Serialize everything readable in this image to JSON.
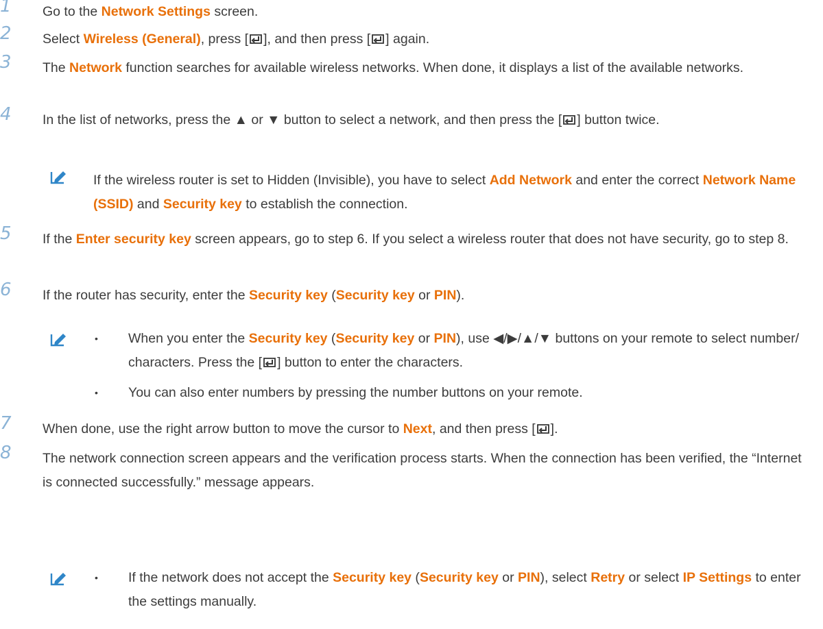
{
  "steps": [
    {
      "num": "1",
      "parts": [
        "Go to the ",
        "Network Settings",
        " screen."
      ]
    },
    {
      "num": "2",
      "parts": [
        "Select ",
        "Wireless (General)",
        ", press [",
        "], and then press [",
        "] again."
      ]
    },
    {
      "num": "3",
      "parts": [
        "The ",
        "Network",
        " function searches for available wireless networks. When done, it displays a list of the available networks."
      ]
    },
    {
      "num": "4",
      "parts": [
        "In the list of networks, press the ▲ or ▼ button to select a network, and then press the [",
        "] button twice."
      ]
    },
    {
      "num": "5",
      "parts": [
        "If the ",
        "Enter security key",
        " screen appears, go to step 6. If you select a wireless router that does not have security, go to step 8."
      ]
    },
    {
      "num": "6",
      "parts": [
        "If the router has security, enter the ",
        "Security key",
        " (",
        "Security key",
        " or ",
        "PIN",
        ")."
      ]
    },
    {
      "num": "7",
      "parts": [
        "When done, use the right arrow button to move the cursor to ",
        "Next",
        ", and then press [",
        "]."
      ]
    },
    {
      "num": "8",
      "parts": [
        "The network connection screen appears and the verification process starts. When the connection has been verified, the “Internet is connected successfully.” message appears."
      ]
    }
  ],
  "notes": {
    "note4": [
      "If the wireless router is set to Hidden (Invisible), you have to select ",
      "Add Network",
      " and enter the correct ",
      "Network Name (SSID)",
      " and ",
      "Security key",
      " to establish the connection."
    ],
    "note6a": [
      "When you enter the ",
      "Security key",
      " (",
      "Security key",
      " or ",
      "PIN",
      "), use ◀/▶/▲/▼ buttons on your remote to select number/ characters. Press the [",
      "] button to enter the characters."
    ],
    "note6b": [
      "You can also enter numbers by pressing the number buttons on your remote."
    ],
    "note8a": [
      "If the network does not accept the ",
      "Security key",
      " (",
      "Security key",
      " or ",
      "PIN",
      "), select ",
      "Retry",
      " or select ",
      "IP Settings",
      " to enter the settings manually."
    ]
  },
  "bullet_glyph": "•",
  "icons": {
    "enter": "enter-key-icon",
    "note": "note-pencil-icon"
  },
  "colors": {
    "highlight": "#e8700a",
    "step_number": "#8bb3d6",
    "note_icon": "#2f86c8",
    "text": "#3c3c3c"
  }
}
